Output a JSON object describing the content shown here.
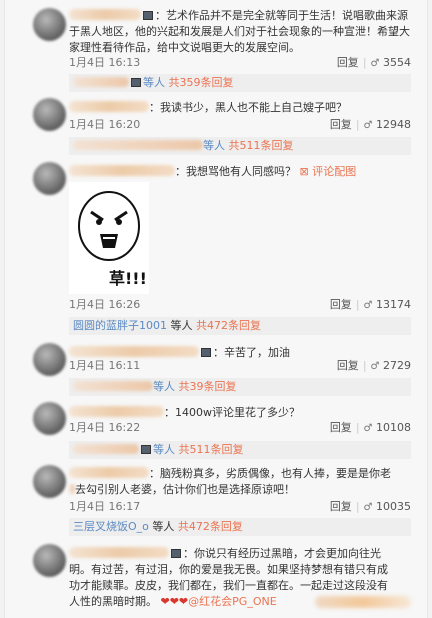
{
  "comments": [
    {
      "text": "：艺术作品并不是完全就等同于生活！说唱歌曲来源于黑人地区，他的兴起和发展是人们对于社会现象的一种宣泄！希望大家理性看待作品，给中文说唱更大的发展空间。",
      "time": "1月4日 16:13",
      "reply": "回复",
      "likes": "3554",
      "sub": {
        "who": "等人",
        "link": "共359条回复"
      }
    },
    {
      "text": "：我读书少，黑人也不能上自己嫂子吧？",
      "time": "1月4日 16:20",
      "reply": "回复",
      "likes": "12948",
      "sub": {
        "who": "等人",
        "link": "共511条回复"
      }
    },
    {
      "text": "：我想骂他有人同感吗？",
      "image_link": "评论配图",
      "meme_caption": "草!!!",
      "time": "1月4日 16:26",
      "reply": "回复",
      "likes": "13174",
      "sub": {
        "name": "圆圆的蓝胖子1001",
        "who": "等人",
        "link": "共472条回复"
      }
    },
    {
      "text": "：辛苦了，加油",
      "time": "1月4日 16:11",
      "reply": "回复",
      "likes": "2729",
      "sub": {
        "who": "等人",
        "link": "共39条回复"
      }
    },
    {
      "text": "：1400w评论里花了多少？",
      "time": "1月4日 16:22",
      "reply": "回复",
      "likes": "10108",
      "sub": {
        "who": "等人",
        "link": "共511条回复"
      }
    },
    {
      "text_line1": "：脑残粉真多，劣质偶像，也有人捧，要是是你老",
      "text_line2": "去勾引别人老婆，估计你们也是选择原谅吧！",
      "time": "1月4日 16:17",
      "reply": "回复",
      "likes": "10035",
      "sub": {
        "name": "三层叉烧饭O_o",
        "who": "等人",
        "link": "共472条回复"
      }
    },
    {
      "text_line1": "：你说只有经历过黑暗，才会更加向往光",
      "text_line2": "明。有过苦，有过泪，你的爱是我无畏。如果坚持梦想有错只有成",
      "text_line3": "功才能赎罪。皮皮，我们都在，我们一直都在。一起走过这段没有",
      "text_line4": "人性的黑暗时期。",
      "hearts": "❤❤❤",
      "mention": "@红花会PG_ONE"
    }
  ]
}
